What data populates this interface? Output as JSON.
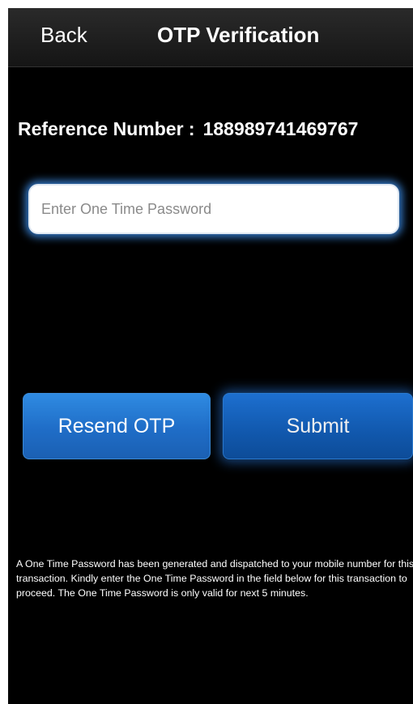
{
  "nav": {
    "back_label": "Back",
    "title": "OTP Verification"
  },
  "reference": {
    "label": "Reference Number :",
    "value": "188989741469767"
  },
  "otp_field": {
    "placeholder": "Enter One Time Password",
    "value": ""
  },
  "buttons": {
    "resend_label": "Resend OTP",
    "submit_label": "Submit"
  },
  "info": {
    "message": "A One Time Password has been generated and dispatched to your mobile number for this transaction. Kindly enter the One Time Password in the field below for this transaction to proceed.  The One Time Password is only valid for next 5 minutes."
  },
  "colors": {
    "background": "#000000",
    "accent_blue": "#1f6dc7",
    "glow_blue": "#3c8ce6"
  }
}
